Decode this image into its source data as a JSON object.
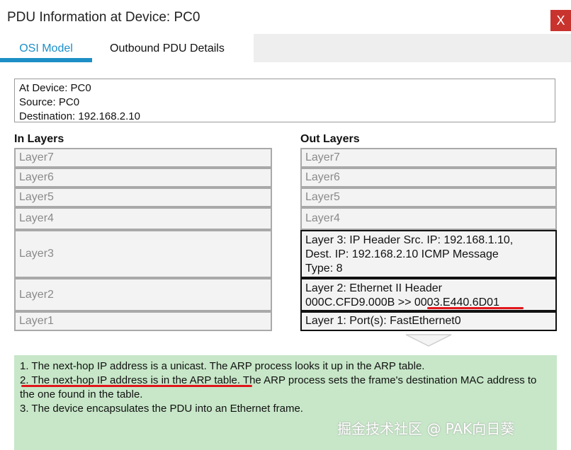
{
  "window": {
    "title": "PDU Information at Device: PC0",
    "close_label": "X"
  },
  "tabs": [
    {
      "label": "OSI Model",
      "selected": true
    },
    {
      "label": "Outbound PDU Details",
      "selected": false
    }
  ],
  "device_info": {
    "line1": "At Device: PC0",
    "line2": "Source: PC0",
    "line3": "Destination: 192.168.2.10"
  },
  "in_layers": {
    "header": "In Layers",
    "items": [
      "Layer7",
      "Layer6",
      "Layer5",
      "Layer4",
      "Layer3",
      "Layer2",
      "Layer1"
    ]
  },
  "out_layers": {
    "header": "Out Layers",
    "layer7": "Layer7",
    "layer6": "Layer6",
    "layer5": "Layer5",
    "layer4": "Layer4",
    "layer3": {
      "line1": "Layer 3: IP Header Src. IP: 192.168.1.10,",
      "line2": "Dest. IP: 192.168.2.10 ICMP Message",
      "line3": "Type: 8"
    },
    "layer2": {
      "line1": "Layer 2: Ethernet II Header",
      "line2": "000C.CFD9.000B >> 0003.E440.6D01"
    },
    "layer1": "Layer 1: Port(s): FastEthernet0"
  },
  "steps": {
    "s1": "1. The next-hop IP address is a unicast. The ARP process looks it up in the ARP table.",
    "s2": "2. The next-hop IP address is in the ARP table. The ARP process sets the frame's destination MAC address to the one found in the table.",
    "s3": "3. The device encapsulates the PDU into an Ethernet frame."
  },
  "watermark": "掘金技术社区 @ PAK向日葵",
  "colors": {
    "accent": "#1d8fc6",
    "close": "#c9332e",
    "steps_bg": "#c7e7c8",
    "annotation": "#e0161b"
  }
}
